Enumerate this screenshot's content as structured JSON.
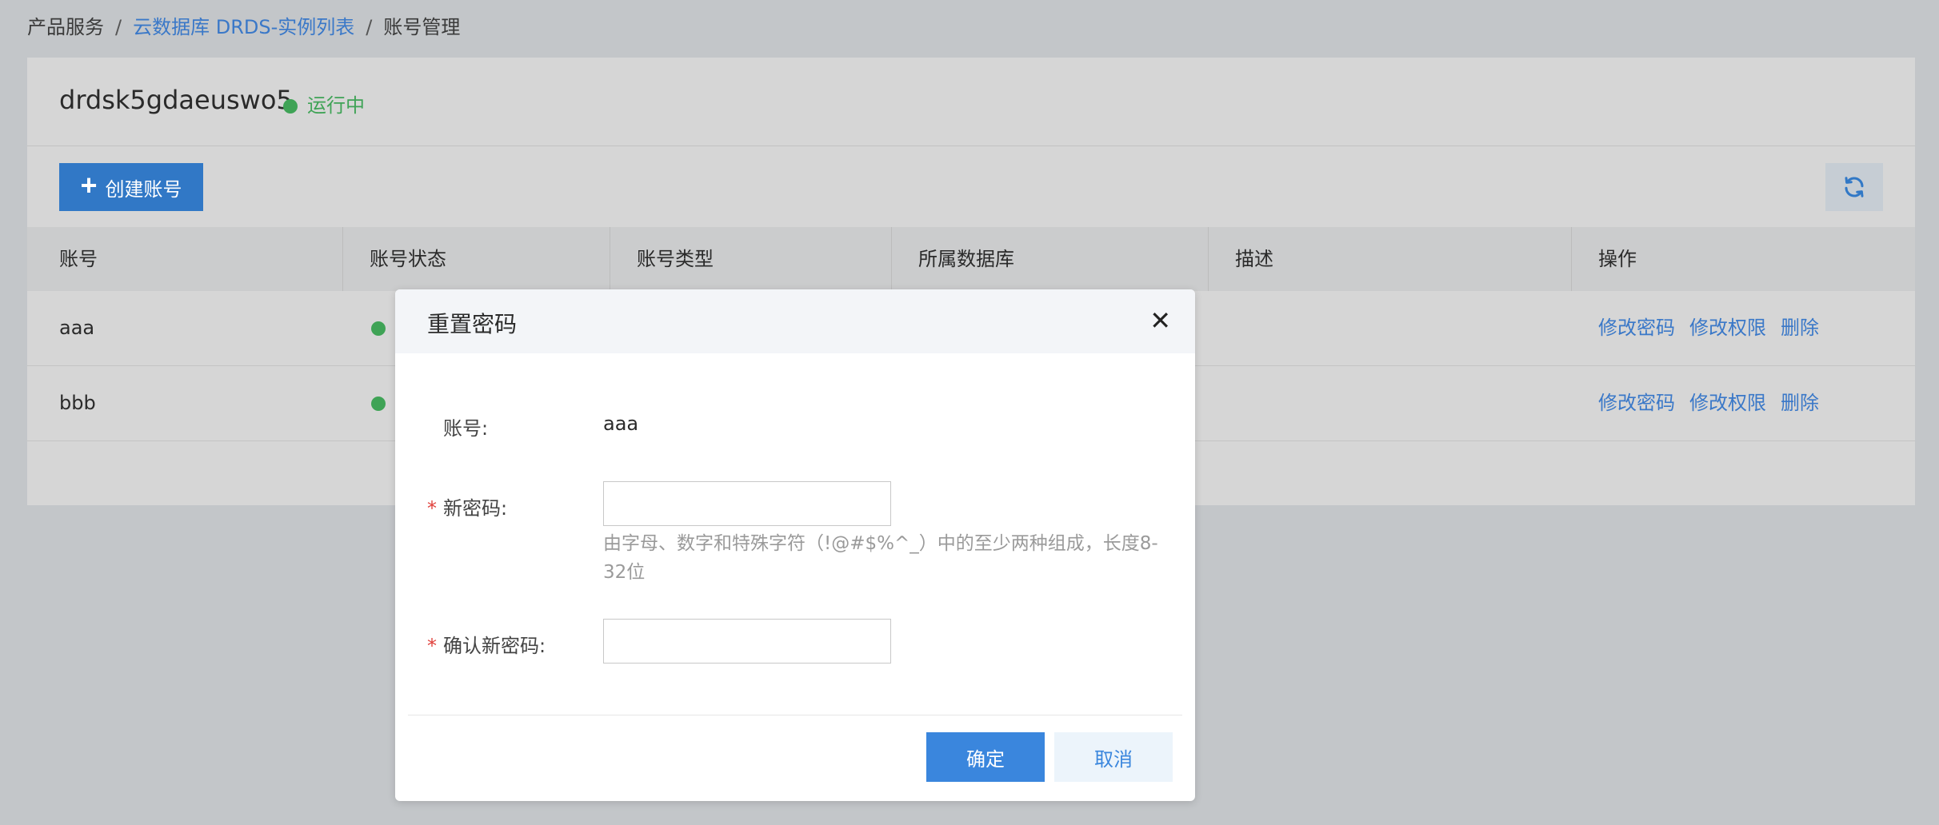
{
  "breadcrumb": {
    "item1": "产品服务",
    "item2": "云数据库 DRDS-实例列表",
    "item3": "账号管理",
    "separator": "/"
  },
  "instance": {
    "name": "drdsk5gdaeuswo5",
    "status": "运行中",
    "status_color": "#3fa356"
  },
  "toolbar": {
    "create_label": "创建账号",
    "create_icon": "plus-icon",
    "refresh_icon": "refresh-icon"
  },
  "table": {
    "columns": [
      "账号",
      "账号状态",
      "账号类型",
      "所属数据库",
      "描述",
      "操作"
    ],
    "rows": [
      {
        "account": "aaa",
        "actions": [
          "修改密码",
          "修改权限",
          "删除"
        ]
      },
      {
        "account": "bbb",
        "actions": [
          "修改密码",
          "修改权限",
          "删除"
        ]
      }
    ]
  },
  "modal": {
    "title": "重置密码",
    "account_label": "账号:",
    "account_value": "aaa",
    "new_password_label": "新密码:",
    "new_password_hint": "由字母、数字和特殊字符（!@#$%^_）中的至少两种组成，长度8-32位",
    "confirm_password_label": "确认新密码:",
    "required_mark": "*",
    "ok_label": "确定",
    "cancel_label": "取消"
  },
  "colors": {
    "primary": "#3178c6",
    "link": "#3a78c8",
    "required": "#e0413c"
  }
}
